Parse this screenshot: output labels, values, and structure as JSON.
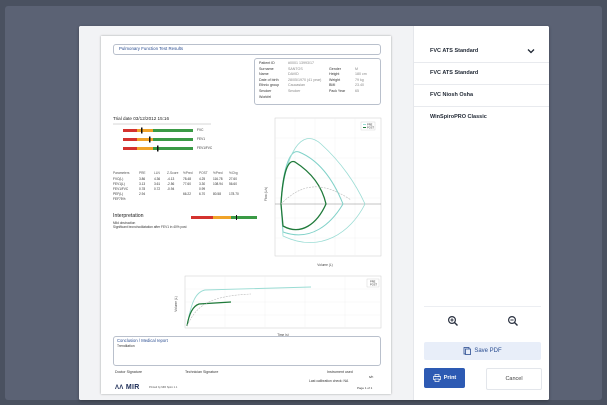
{
  "report": {
    "title": "Pulmonary Function Test Results",
    "patient": {
      "labels": [
        "Patient ID",
        "Surname",
        "Name",
        "Date of birth",
        "Ethnic group",
        "Smoker",
        "Workfel"
      ],
      "values": [
        "#0001 13993/17",
        "SANTOS",
        "DAVID",
        "28/05/1970 (41 year)",
        "Caucasian",
        "Smoker",
        ""
      ],
      "labels2": [
        "Gender",
        "Height",
        "Weight",
        "BMI",
        "Pack Year"
      ],
      "values2": [
        "M",
        "180 cm",
        "79 kg",
        "23.40",
        "65"
      ]
    },
    "trial_date": "Trial date 03/12/2012 15:16",
    "bars": [
      "FVC",
      "FEV1",
      "FEV1/FVC"
    ],
    "table_header": [
      "Parameters",
      "PRE",
      "LLN",
      "Z-Score",
      "%Pred",
      "POST",
      "%Pred",
      "%Chg"
    ],
    "table_rows": [
      [
        "FVC(L)",
        "3.86",
        "4.36",
        "-4.13",
        "78.48",
        "4.25",
        "116.78",
        "27.60"
      ],
      [
        "FEV1(L)",
        "3.13",
        "3.61",
        "-2.56",
        "77.60",
        "3.30",
        "108.94",
        "56.60"
      ],
      [
        "FEV1/FVC",
        "0.78",
        "0.72",
        "-0.94",
        "",
        "0.99",
        "",
        ""
      ],
      [
        "PEF(L)",
        "2.94",
        "",
        "",
        "66.22",
        "6.70",
        "80.58",
        "178.70"
      ],
      [
        "FEF75%",
        "",
        "",
        "",
        "",
        "",
        "",
        ""
      ]
    ],
    "interpretation_title": "Interpretation",
    "interpretation_lines": [
      "Mild obstruction",
      "Significant bronchodilatation after FEV1 in 40% post"
    ],
    "graph1_legend": [
      "PRE",
      "POST"
    ],
    "graph1_xlabel": "Volume (L)",
    "graph1_ylabel": "Flow (L/s)",
    "graph2_legend": [
      "PRE",
      "POST"
    ],
    "graph2_xlabel": "Time (s)",
    "graph2_ylabel": "Volume (L)",
    "conclusion_title": "Conclusion / Medical report",
    "conclusion_text": "Trendilation",
    "doctor_sig": "Doctor Signature",
    "tech_sig": "Technician Signature",
    "instrument": [
      "Instrument used",
      "s/n",
      "Last calibration check: NA"
    ],
    "logo": "MIR",
    "powered": "Printed by MIR Spiro 1.1",
    "page": "Page 1 of 1"
  },
  "panel": {
    "options": [
      "FVC ATS Standard",
      "FVC ATS Standard",
      "FVC Niosh Osha",
      "WinSpiroPRO Classic"
    ],
    "save_label": "Save PDF",
    "print_label": "Print",
    "cancel_label": "Cancel"
  },
  "colors": {
    "primary": "#2d5ab3",
    "save_bg": "#e8eef9",
    "curve_dark": "#1f7a3a",
    "curve_light": "#7fd1c8"
  },
  "icons": [
    "chevron-down-icon",
    "zoom-in-icon",
    "zoom-out-icon",
    "pdf-icon",
    "printer-icon"
  ]
}
